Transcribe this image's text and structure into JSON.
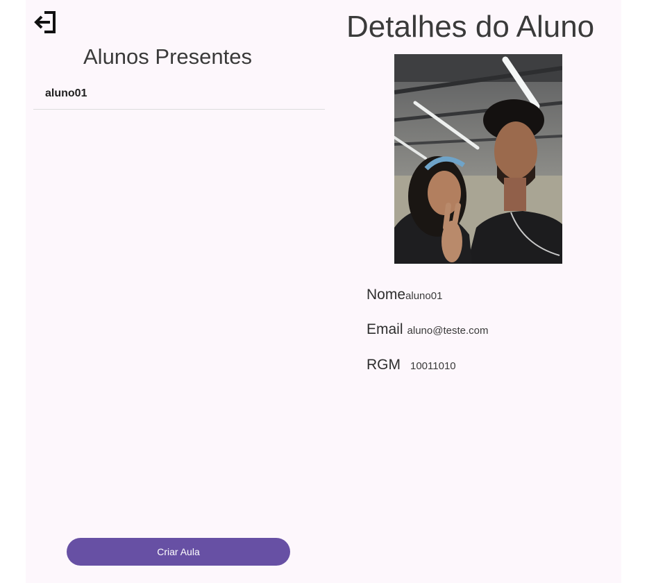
{
  "left_panel": {
    "title": "Alunos Presentes",
    "students": [
      {
        "label": "aluno01"
      }
    ],
    "create_button_label": "Criar Aula"
  },
  "toolbar": {
    "logout_icon": "logout-arrow-icon"
  },
  "detail": {
    "title": "Detalhes do Aluno",
    "photo_icon": "student-photo",
    "fields": {
      "name": {
        "label": "Nome",
        "value": "aluno01"
      },
      "email": {
        "label": "Email",
        "value": "aluno@teste.com"
      },
      "rgm": {
        "label": "RGM",
        "value": "10011010"
      }
    }
  },
  "colors": {
    "background": "#fdf7fc",
    "primary": "#6750a4",
    "divider": "#dcdcdc"
  }
}
